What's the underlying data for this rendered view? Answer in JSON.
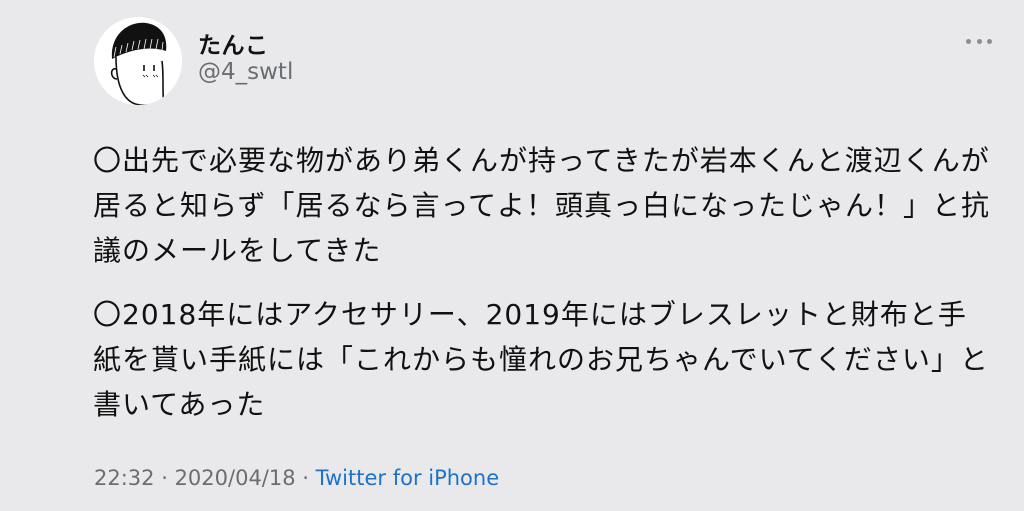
{
  "tweet": {
    "author_name": "たんこ",
    "author_handle": "@4_swtl",
    "paragraphs": [
      "〇出先で必要な物があり弟くんが持ってきたが岩本くんと渡辺くんが居ると知らず「居るなら言ってよ！頭真っ白になったじゃん！」と抗議のメールをしてきた",
      "〇2018年にはアクセサリー、2019年にはブレスレットと財布と手紙を貰い手紙には「これからも憧れのお兄ちゃんでいてください」と書いてあった"
    ],
    "time": "22:32",
    "date": "2020/04/18",
    "separator": " · ",
    "source": "Twitter for iPhone"
  },
  "icons": {
    "avatar": "cartoon-avatar",
    "more": "more-options-icon"
  },
  "colors": {
    "background": "#e9e9ec",
    "text": "#111111",
    "secondary": "#6a6d72",
    "link": "#1d72c9"
  }
}
